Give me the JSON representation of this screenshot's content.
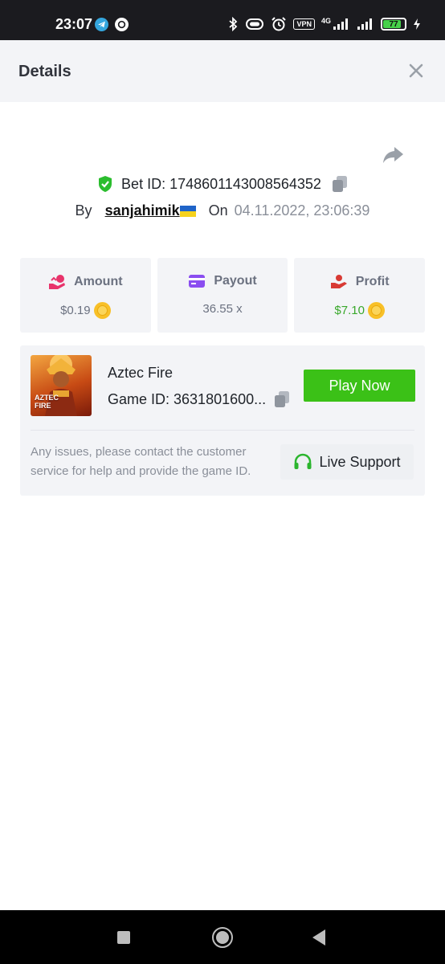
{
  "status_bar": {
    "time": "23:07",
    "vpn_label": "VPN",
    "network_label": "4G",
    "battery_level": "77"
  },
  "header": {
    "title": "Details",
    "close_icon": "close-icon"
  },
  "bet": {
    "id_label": "Bet ID: 1748601143008564352",
    "by_label": "By",
    "username": "sanjahimik",
    "on_label": "On",
    "datetime": "04.11.2022, 23:06:39"
  },
  "stats": {
    "amount": {
      "label": "Amount",
      "value": "$0.19",
      "icon": "money-hand-icon",
      "color": "#e8336b"
    },
    "payout": {
      "label": "Payout",
      "value": "36.55 x",
      "icon": "card-icon",
      "color": "#8a4df0"
    },
    "profit": {
      "label": "Profit",
      "value": "$7.10",
      "icon": "hand-coin-icon",
      "color": "#d83a34",
      "value_color": "#3aa82c"
    }
  },
  "game": {
    "name": "Aztec Fire",
    "id_text": "Game ID: 3631801600...",
    "thumb_line1": "AZTEC",
    "thumb_line2": "FIRE",
    "play_label": "Play Now",
    "help_text": "Any issues, please contact the customer service for help and provide the game ID.",
    "support_label": "Live Support"
  },
  "colors": {
    "accent_green": "#3bc117",
    "panel_bg": "#f3f4f7",
    "muted_text": "#8a8f99"
  }
}
